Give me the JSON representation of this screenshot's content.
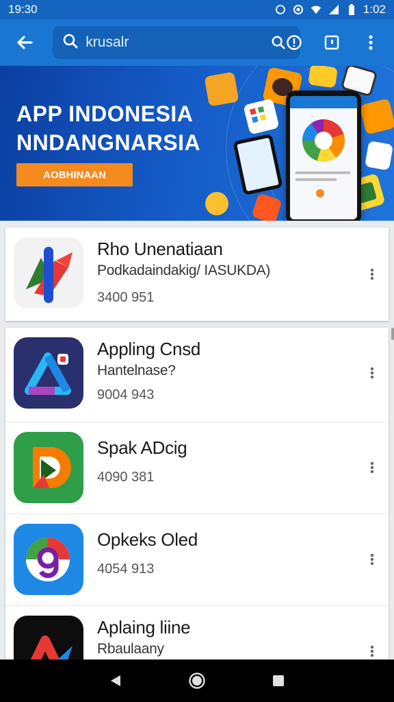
{
  "status_bar": {
    "time": "19:30",
    "clock": "1:02",
    "icons": [
      "whatsapp-icon",
      "circle-app-icon",
      "wifi-icon",
      "signal-icon",
      "battery-icon"
    ]
  },
  "app_bar": {
    "search_value": "",
    "search_placeholder": "krusalr",
    "icons": [
      "back-arrow-icon",
      "search-icon",
      "info-icon",
      "tab-icon",
      "more-vert-icon"
    ]
  },
  "banner": {
    "line1": "APP INDONESIA",
    "line2": "NNDANGNARSIA",
    "cta": "AOBHINAAN"
  },
  "featured": {
    "name": "Rho Unenatiaan",
    "subtitle": "Podkadaindakig/ IASUKDA)",
    "count": "3400 951"
  },
  "apps": [
    {
      "name": "Appling Cnsd",
      "subtitle": "Hantelnase?",
      "count": "9004 943"
    },
    {
      "name": "Spak ADcig",
      "subtitle": "",
      "count": "4090 381"
    },
    {
      "name": "Opkeks Oled",
      "subtitle": "",
      "count": "4054 913"
    },
    {
      "name": "Aplaing liine",
      "subtitle": "Rbaulaany",
      "count": ""
    }
  ],
  "colors": {
    "appbar": "#1976d2",
    "statusbar": "#1565c0",
    "banner_cta": "#f58a1f",
    "navbar": "#000000"
  },
  "nav": [
    "back-triangle-icon",
    "home-circle-icon",
    "recents-square-icon"
  ]
}
